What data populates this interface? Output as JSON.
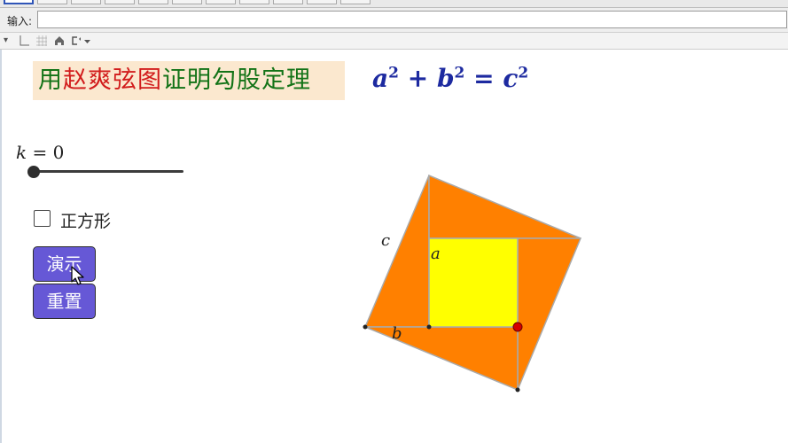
{
  "input_bar": {
    "label": "输入:",
    "value": ""
  },
  "title": {
    "part1": "用",
    "part2": "赵爽弦图",
    "part3": "证明勾股定理"
  },
  "formula": {
    "a": "a",
    "b": "b",
    "c": "c",
    "exp": "2",
    "plus": "+",
    "equals": "="
  },
  "slider": {
    "variable": "k",
    "equals": "=",
    "value": "0",
    "level": 0
  },
  "checkbox": {
    "label": "正方形",
    "checked": false
  },
  "buttons": {
    "demo": "演示",
    "reset": "重置"
  },
  "figure": {
    "label_c": "c",
    "label_a": "a",
    "label_b": "b"
  },
  "colors": {
    "outer_square": "#ff8000",
    "inner_square": "#ffff00",
    "button": "#6658d6",
    "title_green": "#137317",
    "title_red": "#d21c1c",
    "formula": "#1d2aa0",
    "title_bg": "#fbe8cf",
    "point_red": "#d40000"
  }
}
